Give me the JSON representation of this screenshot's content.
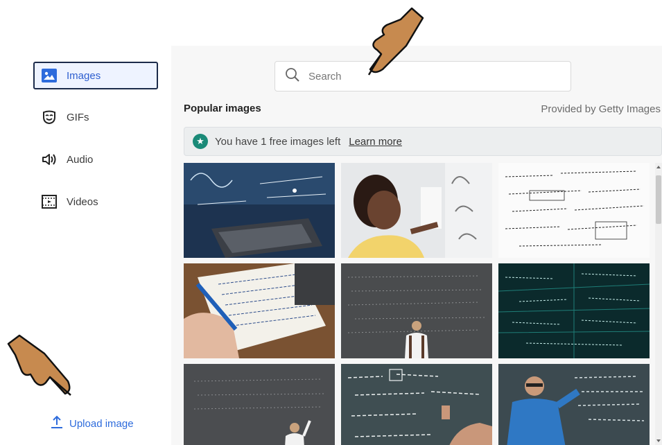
{
  "sidebar": {
    "items": [
      {
        "label": "Images",
        "icon": "image-icon",
        "active": true
      },
      {
        "label": "GIFs",
        "icon": "gif-mask-icon",
        "active": false
      },
      {
        "label": "Audio",
        "icon": "speaker-icon",
        "active": false
      },
      {
        "label": "Videos",
        "icon": "film-icon",
        "active": false
      }
    ],
    "upload_label": "Upload image"
  },
  "search": {
    "placeholder": "Search"
  },
  "section": {
    "title": "Popular images",
    "provider": "Provided by Getty Images"
  },
  "banner": {
    "text": "You have 1 free images left",
    "link": "Learn more"
  },
  "colors": {
    "accent": "#2d6bdc",
    "active_border": "#1b2a4a",
    "badge": "#1a8a78"
  }
}
